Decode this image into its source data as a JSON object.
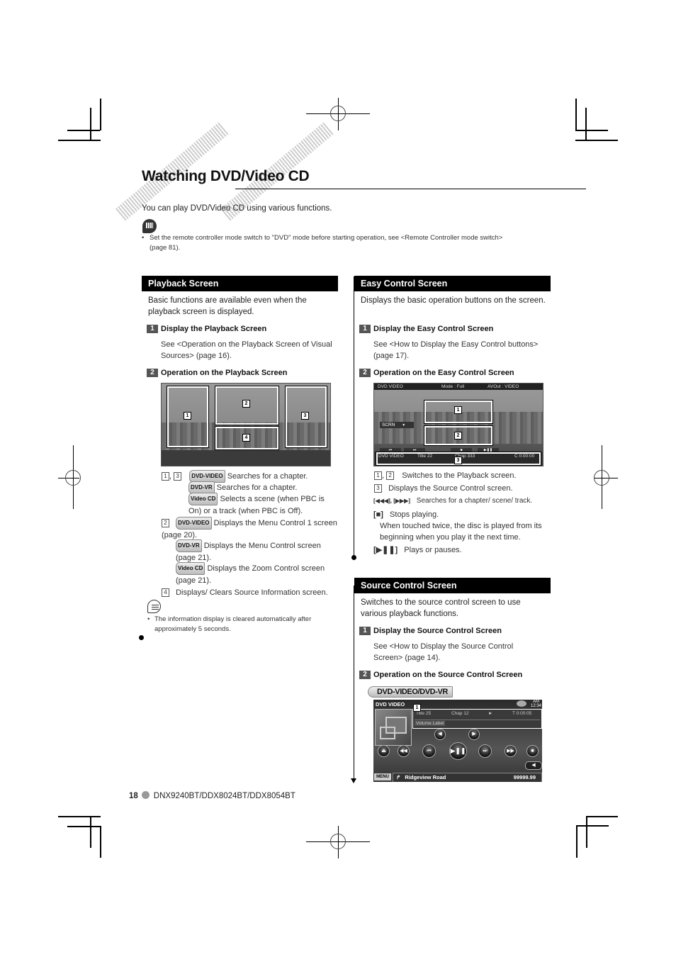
{
  "page": {
    "title": "Watching DVD/Video CD",
    "intro": "You can play DVD/Video CD using various functions.",
    "note": "Set the remote controller mode switch to \"DVD\" mode before starting operation, see <Remote Controller mode switch>",
    "note_page": "(page 81).",
    "footer": {
      "page_number": "18",
      "models": "DNX9240BT/DDX8024BT/DDX8054BT"
    }
  },
  "playback": {
    "header": "Playback Screen",
    "desc": "Basic functions are available even when the playback screen is displayed.",
    "step1": {
      "num": "1",
      "title": "Display the Playback Screen",
      "text": "See <Operation on the Playback Screen of Visual Sources> (page 16)."
    },
    "step2": {
      "num": "2",
      "title": "Operation on the Playback Screen"
    },
    "screen_badges": [
      "1",
      "2",
      "3",
      "4"
    ],
    "items": [
      {
        "keys": "1, 3",
        "disc": "DVD-VIDEO",
        "text": "Searches for a chapter."
      },
      {
        "keys": "",
        "disc": "DVD-VR",
        "text": "Searches for a chapter."
      },
      {
        "keys": "",
        "disc": "Video CD",
        "text": "Selects a scene (when PBC is On) or a track (when PBC is Off)."
      },
      {
        "keys": "2",
        "disc": "DVD-VIDEO",
        "text": "Displays the Menu Control 1 screen (page 20)."
      },
      {
        "keys": "",
        "disc": "DVD-VR",
        "text": "Displays the Menu Control screen (page 21)."
      },
      {
        "keys": "",
        "disc": "Video CD",
        "text": "Displays the Zoom Control screen (page 21)."
      },
      {
        "keys": "4",
        "disc": "",
        "text": "Displays/ Clears Source Information screen."
      }
    ],
    "note": "The information display is cleared automatically after approximately 5 seconds."
  },
  "easy": {
    "header": "Easy Control Screen",
    "desc": "Displays the basic operation buttons on the screen.",
    "step1": {
      "num": "1",
      "title": "Display the Easy Control Screen",
      "text": "See <How to Display the Easy Control buttons> (page 17)."
    },
    "step2": {
      "num": "2",
      "title": "Operation on the Easy Control Screen"
    },
    "screen": {
      "top_left": "DVD VIDEO",
      "top_mid": "Mode : Full",
      "top_right": "AVOut : VIDEO",
      "scrn_btn": "SCRN",
      "scrn_arrow": "▼",
      "bottom_src": "DVD VIDEO",
      "bottom_title": "Title 22",
      "bottom_chap": "Chap 333",
      "bottom_time": "C  0:00:00",
      "badges": [
        "1",
        "2",
        "3"
      ],
      "controls": [
        "⏮",
        "⏭",
        "■",
        "▶❚❚"
      ]
    },
    "items": [
      {
        "keys": "1, 2",
        "text": "Switches to the Playback screen."
      },
      {
        "keys": "3",
        "text": "Displays the Source Control screen."
      },
      {
        "keys": "[◀◀◀], [▶▶▶]",
        "text": "Searches for a chapter/ scene/ track."
      },
      {
        "keys": "[■]",
        "text": "Stops playing."
      },
      {
        "keys": "",
        "text": "When touched twice, the disc is played from its beginning when you play it the next time."
      },
      {
        "keys": "[▶❚❚]",
        "text": "Plays or pauses."
      }
    ]
  },
  "source": {
    "header": "Source Control Screen",
    "desc": "Switches to the source control screen to use various playback functions.",
    "step1": {
      "num": "1",
      "title": "Display the Source Control Screen",
      "text": "See <How to Display the Source Control Screen> (page 14)."
    },
    "step2": {
      "num": "2",
      "title": "Operation on the Source Control Screen"
    },
    "disc_label": "DVD-VIDEO/DVD-VR",
    "screen": {
      "src": "DVD VIDEO",
      "clock_ampm": "AM",
      "clock": "12:34",
      "title": "Title  25",
      "chap": "Chap  12",
      "play_state": "►",
      "time": "T  0:00:05",
      "volume_label": "Volume Label",
      "menu": "MENU",
      "nav_road": "Ridgeview Road",
      "nav_dist": "99999.99",
      "badge": "1",
      "buttons": [
        "⏏",
        "◀◀",
        "⏮",
        "▶❚❚",
        "⏭",
        "▶▶",
        "■"
      ],
      "small_buttons": [
        "◀",
        "▶"
      ],
      "back": "◀"
    }
  }
}
